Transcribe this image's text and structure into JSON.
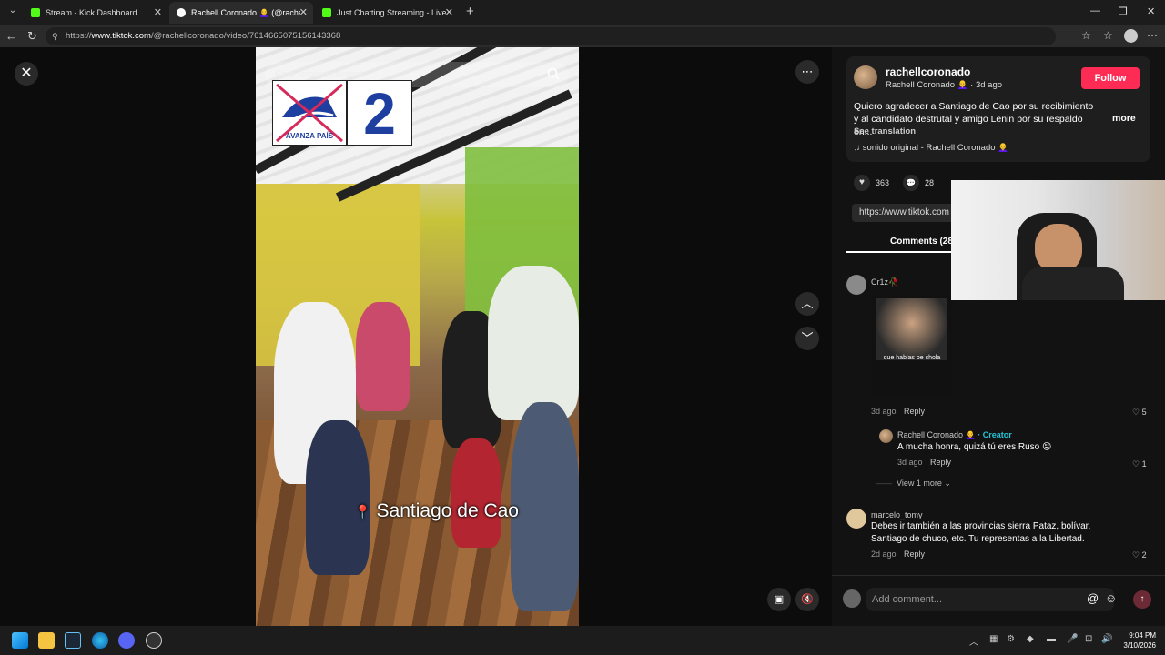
{
  "browser": {
    "tabs": [
      {
        "title": "Stream - Kick Dashboard",
        "color": "#53fc18"
      },
      {
        "title": "Rachell Coronado 👩‍🦲 (@rachellcor…",
        "color": "#ffffff"
      },
      {
        "title": "Just Chatting Streaming - Live Stre",
        "color": "#53fc18"
      }
    ],
    "url_prefix": "https://",
    "url_domain": "www.tiktok.com",
    "url_path": "/@rachellcoronado/video/7614665075156143368"
  },
  "video": {
    "search_placeholder": "Find related content",
    "party_logo_text": "AVANZA PAÍS",
    "list_number": "2",
    "caption": "Santiago de Cao",
    "pin_emoji": "📍"
  },
  "post": {
    "username": "rachellcoronado",
    "display_name": "Rachell Coronado 👩‍🦲",
    "age": "3d ago",
    "follow_label": "Follow",
    "description": "Quiero agradecer a Santiago de Cao por su recibimiento y al candidato destrutal y amigo Lenin por su respaldo en...",
    "more_label": "more",
    "see_translation": "See translation",
    "sound": "sonido original - Rachell Coronado 👩‍🦲",
    "likes": "363",
    "comments_count": "28",
    "link_preview": "https://www.tiktok.com",
    "comments_tab": "Comments (28"
  },
  "comments": [
    {
      "user": "Cr1z🥀",
      "gif_caption": "que hablas oe chola",
      "time": "3d ago",
      "reply_label": "Reply",
      "likes": "5",
      "replies": [
        {
          "user": "Rachell Coronado 👩‍🦲",
          "creator_badge": "· Creator",
          "text": "A mucha honra, quizá tú eres Ruso 😝",
          "time": "3d ago",
          "reply_label": "Reply",
          "likes": "1"
        }
      ],
      "view_more": "View 1 more"
    },
    {
      "user": "marcelo_tomy",
      "text1": "Debes ir también a las provincias sierra Pataz, bolívar,",
      "text2": "Santiago de chuco, etc. Tu representas a la Libertad.",
      "time": "2d ago",
      "reply_label": "Reply",
      "likes": "2"
    }
  ],
  "composer": {
    "placeholder": "Add comment..."
  },
  "taskbar": {
    "time": "9:04 PM",
    "date": "3/10/2026"
  }
}
